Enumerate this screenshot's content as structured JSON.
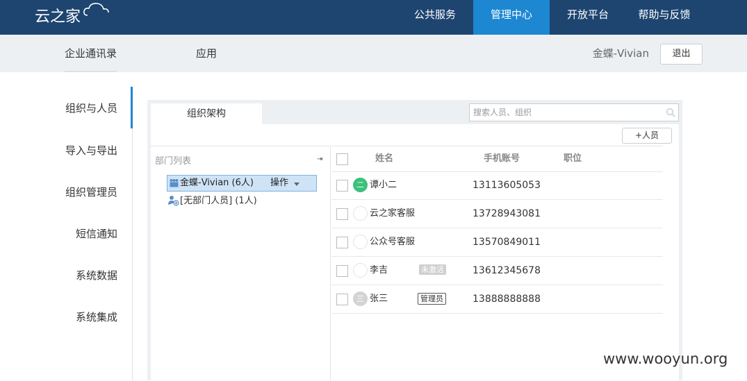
{
  "topbar": {
    "logo": "云之家",
    "nav": [
      "公共服务",
      "管理中心",
      "开放平台",
      "帮助与反馈"
    ],
    "active_nav": "管理中心"
  },
  "subbar": {
    "tabs": [
      "企业通讯录",
      "应用"
    ],
    "user": "金蝶-Vivian",
    "logout": "退出"
  },
  "sidebar": {
    "items": [
      "组织与人员",
      "导入与导出",
      "组织管理员",
      "短信通知",
      "系统数据",
      "系统集成"
    ]
  },
  "main": {
    "tab": "组织架构",
    "search_placeholder": "搜索人员、组织",
    "add_button": "+人员",
    "tree": {
      "header": "部门列表",
      "root": "金蝶-Vivian (6人)",
      "root_action": "操作",
      "child": "[无部门人员] (1人)"
    },
    "table": {
      "headers": [
        "姓名",
        "手机账号",
        "职位"
      ],
      "rows": [
        {
          "avatar": "二",
          "name": "谭小二",
          "phone": "13113605053",
          "badge": ""
        },
        {
          "avatar": "",
          "name": "云之家客服",
          "phone": "13728943081",
          "badge": ""
        },
        {
          "avatar": "",
          "name": "公众号客服",
          "phone": "13570849011",
          "badge": ""
        },
        {
          "avatar": "",
          "name": "李吉",
          "phone": "13612345678",
          "badge": "未激活"
        },
        {
          "avatar": "三",
          "name": "张三",
          "phone": "13888888888",
          "badge": "管理员"
        }
      ]
    }
  },
  "watermark": "www.wooyun.org",
  "colors": {
    "topbar": "#1e4570",
    "accent": "#1d87d2",
    "avatar_green": "#3cc07a",
    "avatar_gray": "#d3d3d3"
  }
}
